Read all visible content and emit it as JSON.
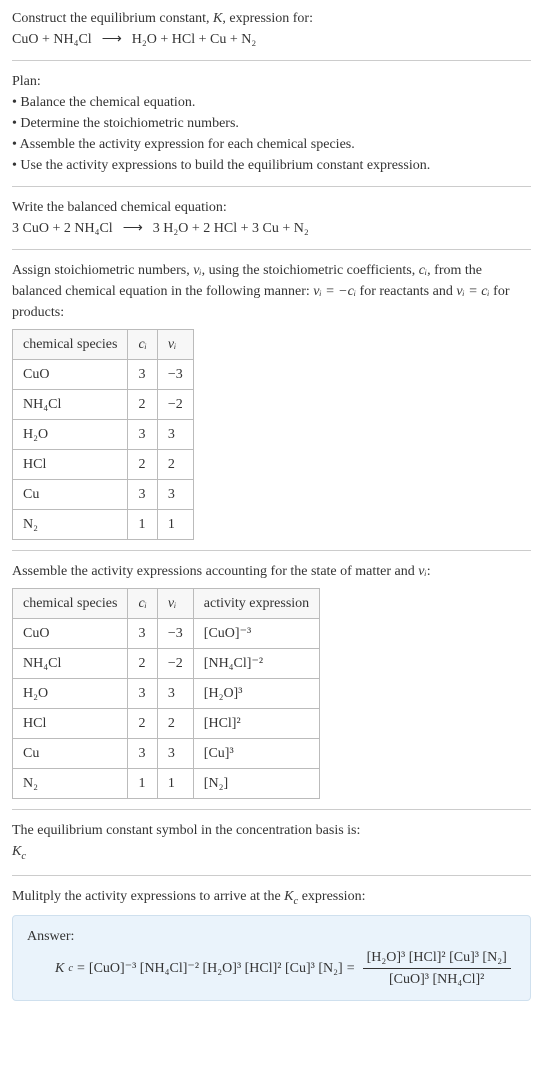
{
  "intro": {
    "line1_a": "Construct the equilibrium constant, ",
    "line1_K": "K",
    "line1_b": ", expression for:",
    "reaction_lhs": "CuO + NH₄Cl",
    "reaction_arrow": "⟶",
    "reaction_rhs": "H₂O + HCl + Cu + N₂"
  },
  "plan": {
    "title": "Plan:",
    "b1": "• Balance the chemical equation.",
    "b2": "• Determine the stoichiometric numbers.",
    "b3": "• Assemble the activity expression for each chemical species.",
    "b4": "• Use the activity expressions to build the equilibrium constant expression."
  },
  "balanced": {
    "title": "Write the balanced chemical equation:",
    "lhs": "3 CuO + 2 NH₄Cl",
    "arrow": "⟶",
    "rhs": "3 H₂O + 2 HCl + 3 Cu + N₂"
  },
  "stoich": {
    "p1a": "Assign stoichiometric numbers, ",
    "p1b": ", using the stoichiometric coefficients, ",
    "p1c": ", from the balanced chemical equation in the following manner: ",
    "p1d": " for reactants and ",
    "p1e": " for products:",
    "nu_i": "νᵢ",
    "c_i": "cᵢ",
    "eq1": "νᵢ = −cᵢ",
    "eq2": "νᵢ = cᵢ",
    "headers": {
      "species": "chemical species",
      "ci": "cᵢ",
      "nui": "νᵢ"
    },
    "rows": [
      {
        "species": "CuO",
        "ci": "3",
        "nui": "−3"
      },
      {
        "species": "NH₄Cl",
        "ci": "2",
        "nui": "−2"
      },
      {
        "species": "H₂O",
        "ci": "3",
        "nui": "3"
      },
      {
        "species": "HCl",
        "ci": "2",
        "nui": "2"
      },
      {
        "species": "Cu",
        "ci": "3",
        "nui": "3"
      },
      {
        "species": "N₂",
        "ci": "1",
        "nui": "1"
      }
    ]
  },
  "activity": {
    "title_a": "Assemble the activity expressions accounting for the state of matter and ",
    "title_b": ":",
    "nu_i": "νᵢ",
    "headers": {
      "species": "chemical species",
      "ci": "cᵢ",
      "nui": "νᵢ",
      "act": "activity expression"
    },
    "rows": [
      {
        "species": "CuO",
        "ci": "3",
        "nui": "−3",
        "act": "[CuO]⁻³"
      },
      {
        "species": "NH₄Cl",
        "ci": "2",
        "nui": "−2",
        "act": "[NH₄Cl]⁻²"
      },
      {
        "species": "H₂O",
        "ci": "3",
        "nui": "3",
        "act": "[H₂O]³"
      },
      {
        "species": "HCl",
        "ci": "2",
        "nui": "2",
        "act": "[HCl]²"
      },
      {
        "species": "Cu",
        "ci": "3",
        "nui": "3",
        "act": "[Cu]³"
      },
      {
        "species": "N₂",
        "ci": "1",
        "nui": "1",
        "act": "[N₂]"
      }
    ]
  },
  "conc_basis": {
    "line": "The equilibrium constant symbol in the concentration basis is:",
    "Kc": "K",
    "Kc_sub": "c"
  },
  "multiply": {
    "line_a": "Mulitply the activity expressions to arrive at the ",
    "line_b": " expression:",
    "Kc": "K",
    "Kc_sub": "c"
  },
  "answer": {
    "label": "Answer:",
    "Kc": "K",
    "Kc_sub": "c",
    "eq_sign": " = ",
    "flat": "[CuO]⁻³ [NH₄Cl]⁻² [H₂O]³ [HCl]² [Cu]³ [N₂]",
    "frac_num": "[H₂O]³ [HCl]² [Cu]³ [N₂]",
    "frac_den": "[CuO]³ [NH₄Cl]²"
  }
}
